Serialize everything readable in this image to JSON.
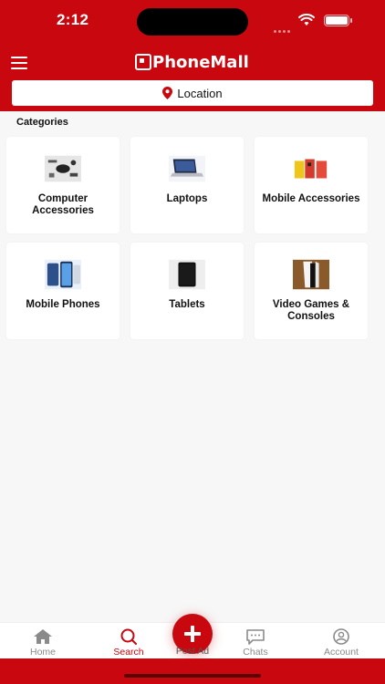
{
  "status": {
    "time": "2:12"
  },
  "header": {
    "brand": "PhoneMall",
    "location_label": "Location"
  },
  "categories": {
    "title": "Categories",
    "items": [
      {
        "label": "Computer Accessories",
        "icon": "computer-accessories-thumb"
      },
      {
        "label": "Laptops",
        "icon": "laptop-thumb"
      },
      {
        "label": "Mobile Accessories",
        "icon": "mobile-accessories-thumb"
      },
      {
        "label": "Mobile Phones",
        "icon": "mobile-phone-thumb"
      },
      {
        "label": "Tablets",
        "icon": "tablet-thumb"
      },
      {
        "label": "Video Games & Consoles",
        "icon": "console-thumb"
      }
    ]
  },
  "tabs": {
    "home": "Home",
    "search": "Search",
    "post": "Post Ad",
    "chats": "Chats",
    "account": "Account"
  },
  "colors": {
    "brand": "#c8070f",
    "background": "#f7f7f7",
    "inactive_tab": "#8a8a8a"
  }
}
